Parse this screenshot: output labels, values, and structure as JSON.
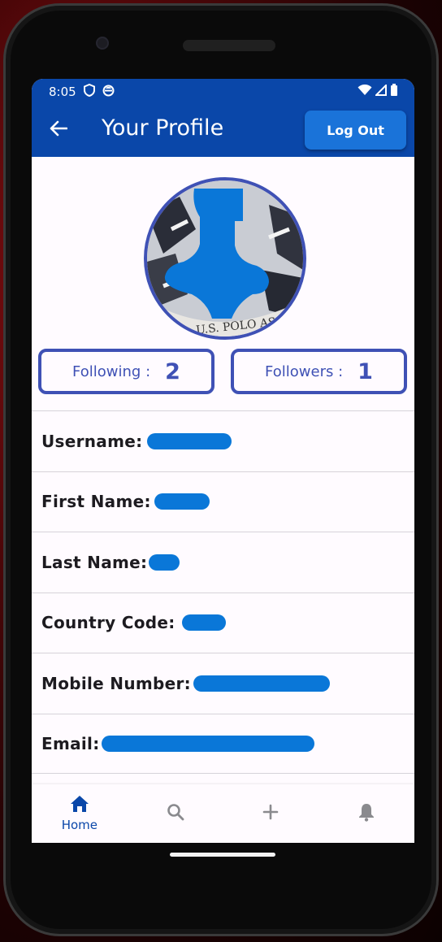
{
  "status_bar": {
    "time": "8:05"
  },
  "app_bar": {
    "title": "Your Profile",
    "logout_label": "Log Out"
  },
  "profile": {
    "photo_text": "U.S. POLO ASSN."
  },
  "stats": {
    "following_label": "Following :",
    "following_count": "2",
    "followers_label": "Followers :",
    "followers_count": "1"
  },
  "fields": [
    {
      "label": "Username:"
    },
    {
      "label": "First Name:"
    },
    {
      "label": "Last Name:"
    },
    {
      "label": "Country Code:"
    },
    {
      "label": "Mobile Number:"
    },
    {
      "label": "Email:"
    }
  ],
  "bottom_nav": {
    "items": [
      {
        "icon": "home-icon",
        "label": "Home",
        "active": true
      },
      {
        "icon": "search-icon",
        "label": ""
      },
      {
        "icon": "plus-icon",
        "label": ""
      },
      {
        "icon": "bell-icon",
        "label": ""
      }
    ]
  },
  "colors": {
    "primary": "#0a47a9",
    "button": "#1a73d9",
    "outline": "#3f51b5",
    "redaction": "#0a77d8"
  }
}
